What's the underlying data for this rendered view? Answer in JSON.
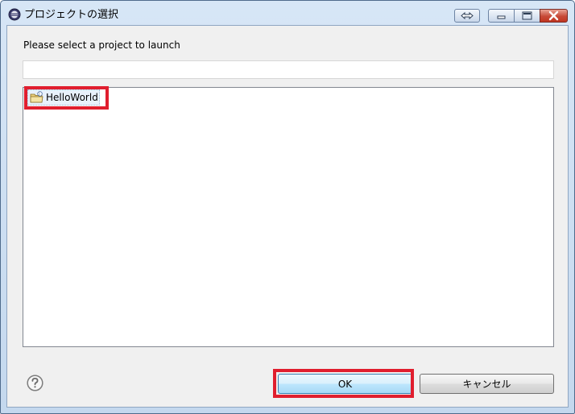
{
  "window": {
    "title": "プロジェクトの選択"
  },
  "dialog": {
    "prompt": "Please select a project to launch",
    "filter": {
      "value": "",
      "placeholder": ""
    },
    "projects": [
      {
        "label": "HelloWorld",
        "icon": "java-project-folder-icon",
        "selected": true
      }
    ]
  },
  "buttons": {
    "ok_label": "OK",
    "cancel_label": "キャンセル",
    "help_icon": "help-question-icon"
  },
  "annotations": {
    "highlight_color": "#e01e2e"
  },
  "colors": {
    "titlebar": "#c4d8ee",
    "close_button": "#c74a38",
    "dialog_background": "#f0f0f0"
  }
}
